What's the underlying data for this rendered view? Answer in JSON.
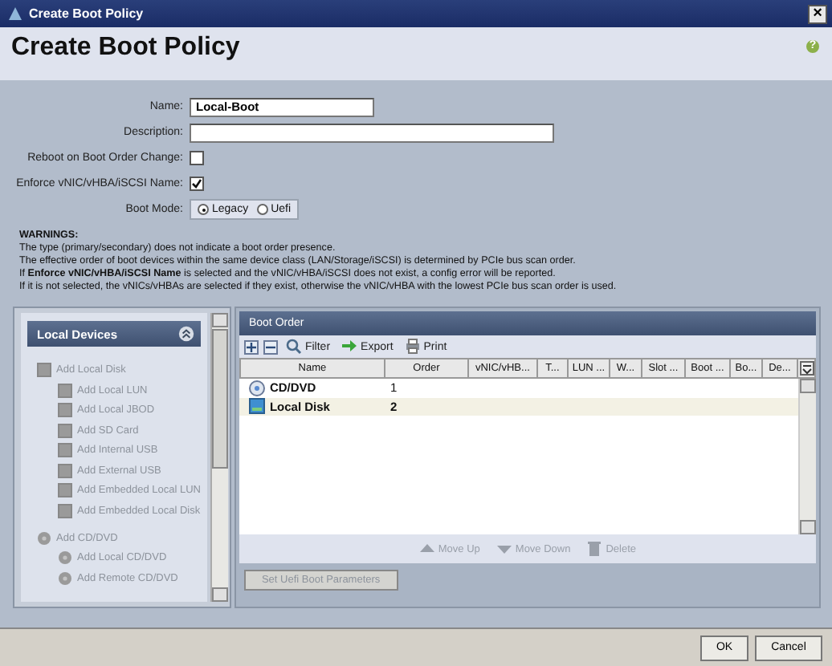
{
  "window": {
    "title": "Create Boot Policy",
    "close": "×"
  },
  "header": {
    "title": "Create Boot Policy",
    "help": "?"
  },
  "form": {
    "name_label": "Name:",
    "name_value": "Local-Boot",
    "description_label": "Description:",
    "reboot_label": "Reboot on Boot Order Change:",
    "reboot_checked": false,
    "enforce_label": "Enforce vNIC/vHBA/iSCSI Name:",
    "enforce_checked": true,
    "boot_mode_label": "Boot Mode:",
    "boot_modes": [
      {
        "label": "Legacy",
        "selected": true
      },
      {
        "label": "Uefi",
        "selected": false
      }
    ]
  },
  "warnings": {
    "title": "WARNINGS:",
    "lines": [
      "The type (primary/secondary) does not indicate a boot order presence.",
      "The effective order of boot devices within the same device class (LAN/Storage/iSCSI) is determined by PCIe bus scan order.",
      "If **Enforce vNIC/vHBA/iSCSI Name** is selected and the vNIC/vHBA/iSCSI does not exist, a config error will be reported.",
      "If it is not selected, the vNICs/vHBAs are selected if they exist, otherwise the vNIC/vHBA with the lowest PCIe bus scan order is used."
    ]
  },
  "local_devices": {
    "title": "Local Devices",
    "expanded": true,
    "items": [
      {
        "label": "Add Local Disk",
        "kind": "disk",
        "disabled": true,
        "children": [
          {
            "label": "Add Local LUN",
            "kind": "disk",
            "disabled": true
          },
          {
            "label": "Add Local JBOD",
            "kind": "disk",
            "disabled": true
          },
          {
            "label": "Add SD Card",
            "kind": "disk",
            "disabled": true
          },
          {
            "label": "Add Internal USB",
            "kind": "disk",
            "disabled": true
          },
          {
            "label": "Add External USB",
            "kind": "disk",
            "disabled": true
          },
          {
            "label": "Add Embedded Local LUN",
            "kind": "disk",
            "disabled": true
          },
          {
            "label": "Add Embedded Local Disk",
            "kind": "disk",
            "disabled": true
          }
        ]
      },
      {
        "label": "Add CD/DVD",
        "kind": "disc",
        "disabled": true,
        "children": [
          {
            "label": "Add Local CD/DVD",
            "kind": "disc",
            "disabled": true
          },
          {
            "label": "Add Remote CD/DVD",
            "kind": "disc",
            "disabled": true
          }
        ]
      }
    ]
  },
  "boot_order": {
    "title": "Boot Order",
    "toolbar": [
      "Filter",
      "Export",
      "Print"
    ],
    "columns": [
      "Name",
      "Order",
      "vNIC/vHB...",
      "T...",
      "LUN ...",
      "W...",
      "Slot ...",
      "Boot ...",
      "Bo...",
      "De..."
    ],
    "rows": [
      {
        "name": "CD/DVD",
        "kind": "disc",
        "order": "1",
        "selected": false
      },
      {
        "name": "Local Disk",
        "kind": "disk",
        "order": "2",
        "selected": true
      }
    ],
    "actions": [
      {
        "label": "Move Up",
        "kind": "up",
        "disabled": true
      },
      {
        "label": "Move Down",
        "kind": "down",
        "disabled": true
      },
      {
        "label": "Delete",
        "kind": "delete",
        "disabled": true
      }
    ],
    "uefi_button": {
      "label": "Set Uefi Boot Parameters",
      "disabled": true
    }
  },
  "buttons": [
    "OK",
    "Cancel"
  ]
}
